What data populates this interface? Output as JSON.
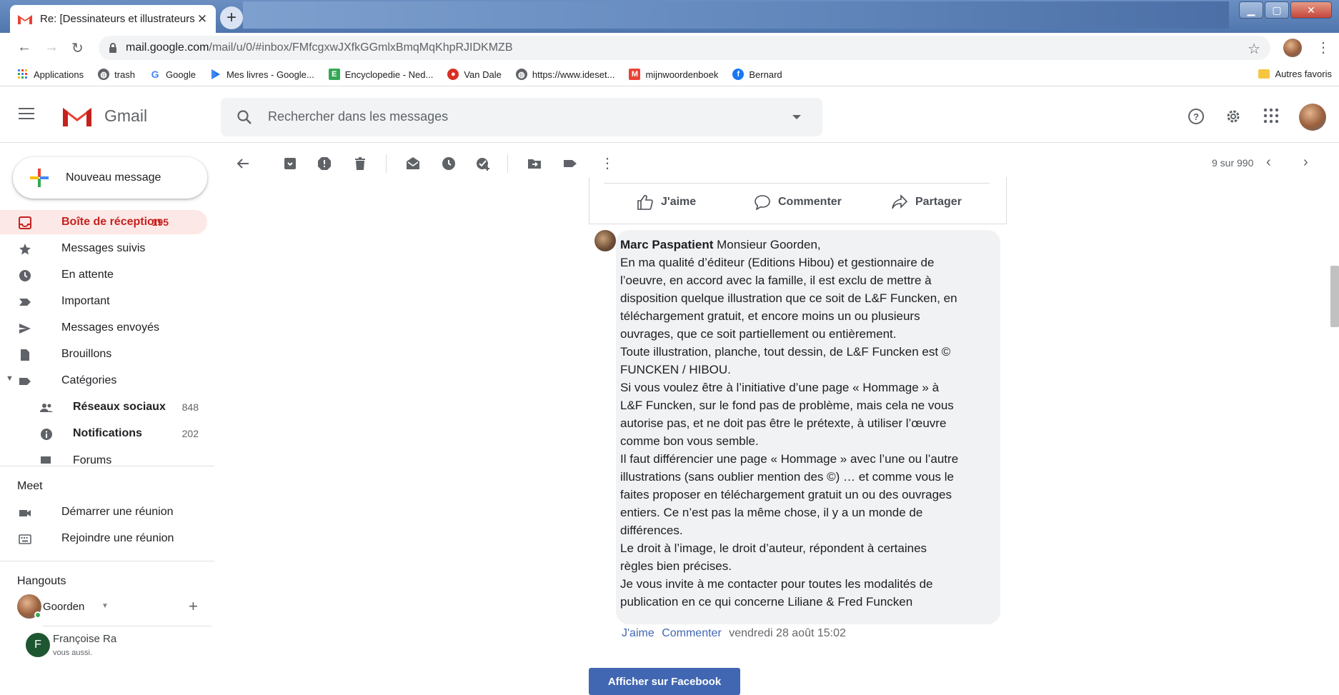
{
  "browser": {
    "tab_title": "Re: [Dessinateurs et illustrateurs",
    "tab_close": "✕",
    "new_tab": "+",
    "url_host": "mail.google.com",
    "url_path": "/mail/u/0/#inbox/FMfcgxwJXfkGGmlxBmqMqKhpRJIDKMZB",
    "bookmarks": [
      {
        "label": "Applications"
      },
      {
        "label": "trash"
      },
      {
        "label": "Google"
      },
      {
        "label": "Mes livres - Google..."
      },
      {
        "label": "Encyclopedie - Ned..."
      },
      {
        "label": "Van Dale"
      },
      {
        "label": "https://www.ideset..."
      },
      {
        "label": "mijnwoordenboek"
      },
      {
        "label": "Bernard"
      }
    ],
    "other_bookmarks": "Autres favoris"
  },
  "gmail": {
    "logo_text": "Gmail",
    "search_placeholder": "Rechercher dans les messages",
    "compose_label": "Nouveau message",
    "nav": [
      {
        "label": "Boîte de réception",
        "count": "195"
      },
      {
        "label": "Messages suivis",
        "count": ""
      },
      {
        "label": "En attente",
        "count": ""
      },
      {
        "label": "Important",
        "count": ""
      },
      {
        "label": "Messages envoyés",
        "count": ""
      },
      {
        "label": "Brouillons",
        "count": ""
      },
      {
        "label": "Catégories",
        "count": ""
      },
      {
        "label": "Réseaux sociaux",
        "count": "848"
      },
      {
        "label": "Notifications",
        "count": "202"
      },
      {
        "label": "Forums",
        "count": ""
      }
    ],
    "meet": {
      "title": "Meet",
      "start": "Démarrer une réunion",
      "join": "Rejoindre une réunion"
    },
    "hangouts": {
      "title": "Hangouts",
      "user": "Goorden",
      "add": "+",
      "contact_name": "Françoise Ra",
      "contact_initial": "F",
      "contact_status": "vous aussi."
    },
    "pager": "9 sur 990",
    "colors": {
      "accent": "#c5221f",
      "active_bg": "#fce8e6",
      "facebook": "#4267b2"
    }
  },
  "message": {
    "actions": {
      "like": "J'aime",
      "comment": "Commenter",
      "share": "Partager"
    },
    "author": "Marc Paspatient",
    "lines": [
      " Monsieur Goorden,",
      "En ma qualité d’éditeur (Editions Hibou) et gestionnaire de",
      "l’oeuvre, en accord avec la famille, il est exclu de mettre à",
      "disposition quelque illustration que ce soit de L&F Funcken, en",
      "téléchargement gratuit, et encore moins un ou plusieurs",
      "ouvrages, que ce soit partiellement ou entièrement.",
      "Toute illustration, planche, tout dessin, de L&F Funcken est ©",
      "FUNCKEN / HIBOU.",
      "Si vous voulez être à l’initiative d’une page « Hommage » à",
      "L&F Funcken, sur le fond pas de problème, mais cela ne vous",
      "autorise pas, et ne doit pas être le prétexte, à utiliser l’œuvre",
      "comme bon vous semble.",
      "Il faut différencier une page « Hommage » avec l’une ou l’autre",
      "illustrations (sans oublier mention des ©) … et comme vous le",
      "faites proposer en téléchargement gratuit un ou des ouvrages",
      "entiers. Ce n’est pas la même chose, il y a un monde de",
      "différences.",
      "Le droit à l’image, le droit d’auteur, répondent à certaines",
      "règles bien précises.",
      "Je vous invite à me contacter pour toutes les modalités de",
      "publication en ce qui concerne Liliane & Fred Funcken"
    ],
    "meta_like": "J'aime",
    "meta_comment": "Commenter",
    "meta_time": "vendredi 28 août 15:02",
    "fb_button": "Afficher sur Facebook"
  }
}
